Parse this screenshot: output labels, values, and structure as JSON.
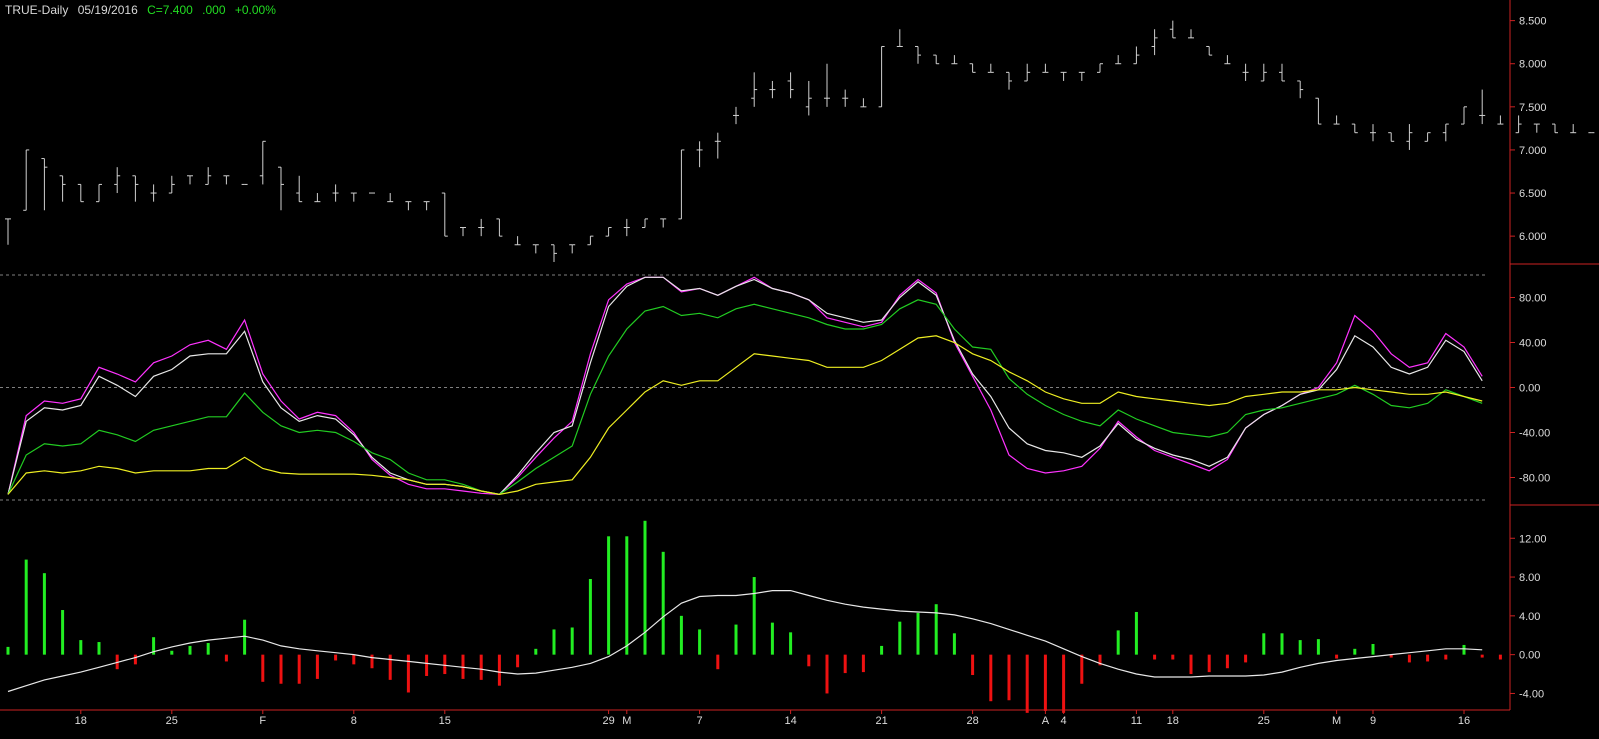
{
  "header": {
    "symbol": "TRUE-Daily",
    "date": "05/19/2016",
    "close": "C=7.400",
    "change": ".000",
    "pct": "+0.00%"
  },
  "colors": {
    "bg": "#000000",
    "axis": "#cc2222",
    "bars": "#d0d0d0",
    "pos": "#22ee22",
    "neg": "#ee1111",
    "magenta": "#ff33ff",
    "white": "#e8e8e8",
    "green": "#22cc22",
    "yellow": "#eeee22",
    "grid": "#aaaaaa"
  },
  "chart_data": [
    {
      "panel": "price",
      "type": "ohlc",
      "ylim": [
        5.7,
        8.6
      ],
      "yticks": [
        "8.500",
        "8.000",
        "7.500",
        "7.000",
        "6.500",
        "6.000"
      ],
      "yvals": [
        8.5,
        8.0,
        7.5,
        7.0,
        6.5,
        6.0
      ],
      "bars": [
        [
          6.2,
          5.8,
          5.9,
          6.2
        ],
        [
          6.3,
          7.0,
          6.3,
          7.0
        ],
        [
          6.9,
          6.9,
          6.3,
          6.8
        ],
        [
          6.7,
          6.7,
          6.4,
          6.6
        ],
        [
          6.6,
          6.6,
          6.4,
          6.4
        ],
        [
          6.4,
          6.6,
          6.4,
          6.6
        ],
        [
          6.6,
          6.8,
          6.5,
          6.7
        ],
        [
          6.7,
          6.7,
          6.4,
          6.6
        ],
        [
          6.5,
          6.6,
          6.4,
          6.5
        ],
        [
          6.5,
          6.7,
          6.5,
          6.6
        ],
        [
          6.7,
          6.7,
          6.6,
          6.7
        ],
        [
          6.6,
          6.8,
          6.6,
          6.7
        ],
        [
          6.7,
          6.7,
          6.6,
          6.7
        ],
        [
          6.6,
          6.6,
          6.6,
          6.6
        ],
        [
          6.7,
          7.1,
          6.6,
          7.1
        ],
        [
          6.8,
          6.8,
          6.3,
          6.6
        ],
        [
          6.5,
          6.7,
          6.4,
          6.4
        ],
        [
          6.4,
          6.5,
          6.4,
          6.4
        ],
        [
          6.5,
          6.6,
          6.4,
          6.5
        ],
        [
          6.5,
          6.5,
          6.4,
          6.5
        ],
        [
          6.5,
          6.5,
          6.5,
          6.5
        ],
        [
          6.4,
          6.5,
          6.4,
          6.4
        ],
        [
          6.4,
          6.4,
          6.3,
          6.4
        ],
        [
          6.4,
          6.4,
          6.3,
          6.4
        ],
        [
          6.5,
          6.5,
          6.0,
          6.0
        ],
        [
          6.1,
          6.1,
          6.0,
          6.1
        ],
        [
          6.1,
          6.2,
          6.0,
          6.1
        ],
        [
          6.2,
          6.2,
          6.0,
          6.0
        ],
        [
          5.9,
          6.0,
          5.9,
          5.9
        ],
        [
          5.9,
          5.9,
          5.8,
          5.9
        ],
        [
          5.9,
          5.9,
          5.7,
          5.8
        ],
        [
          5.9,
          5.9,
          5.8,
          5.9
        ],
        [
          5.9,
          6.0,
          5.9,
          6.0
        ],
        [
          6.0,
          6.1,
          6.0,
          6.1
        ],
        [
          6.1,
          6.2,
          6.0,
          6.1
        ],
        [
          6.1,
          6.2,
          6.1,
          6.2
        ],
        [
          6.2,
          6.2,
          6.1,
          6.2
        ],
        [
          6.2,
          7.0,
          6.2,
          7.0
        ],
        [
          7.0,
          7.1,
          6.8,
          7.0
        ],
        [
          7.1,
          7.2,
          6.9,
          7.1
        ],
        [
          7.4,
          7.5,
          7.3,
          7.4
        ],
        [
          7.6,
          7.9,
          7.5,
          7.7
        ],
        [
          7.7,
          7.8,
          7.6,
          7.7
        ],
        [
          7.8,
          7.9,
          7.6,
          7.7
        ],
        [
          7.5,
          7.8,
          7.4,
          7.6
        ],
        [
          7.6,
          8.0,
          7.5,
          7.6
        ],
        [
          7.6,
          7.7,
          7.5,
          7.6
        ],
        [
          7.5,
          7.6,
          7.5,
          7.5
        ],
        [
          7.5,
          8.2,
          7.5,
          8.2
        ],
        [
          8.2,
          8.4,
          8.2,
          8.2
        ],
        [
          8.2,
          8.2,
          8.0,
          8.1
        ],
        [
          8.1,
          8.1,
          8.0,
          8.0
        ],
        [
          8.0,
          8.1,
          8.0,
          8.0
        ],
        [
          8.0,
          8.0,
          7.9,
          7.9
        ],
        [
          7.9,
          8.0,
          7.9,
          7.9
        ],
        [
          7.9,
          7.9,
          7.7,
          7.8
        ],
        [
          7.8,
          8.0,
          7.8,
          7.9
        ],
        [
          7.9,
          8.0,
          7.9,
          7.9
        ],
        [
          7.9,
          7.9,
          7.8,
          7.9
        ],
        [
          7.9,
          7.9,
          7.8,
          7.9
        ],
        [
          7.9,
          8.0,
          7.9,
          8.0
        ],
        [
          8.0,
          8.1,
          8.0,
          8.0
        ],
        [
          8.0,
          8.2,
          8.0,
          8.1
        ],
        [
          8.2,
          8.4,
          8.1,
          8.3
        ],
        [
          8.4,
          8.5,
          8.3,
          8.3
        ],
        [
          8.3,
          8.4,
          8.3,
          8.3
        ],
        [
          8.2,
          8.2,
          8.1,
          8.1
        ],
        [
          8.0,
          8.1,
          8.0,
          8.0
        ],
        [
          7.9,
          8.0,
          7.8,
          7.9
        ],
        [
          7.8,
          8.0,
          7.8,
          7.9
        ],
        [
          7.9,
          8.0,
          7.8,
          7.8
        ],
        [
          7.8,
          7.8,
          7.6,
          7.7
        ],
        [
          7.6,
          7.6,
          7.3,
          7.3
        ],
        [
          7.3,
          7.4,
          7.3,
          7.3
        ],
        [
          7.3,
          7.3,
          7.2,
          7.2
        ],
        [
          7.2,
          7.3,
          7.1,
          7.2
        ],
        [
          7.2,
          7.2,
          7.1,
          7.1
        ],
        [
          7.1,
          7.3,
          7.0,
          7.2
        ],
        [
          7.1,
          7.2,
          7.1,
          7.2
        ],
        [
          7.2,
          7.3,
          7.1,
          7.3
        ],
        [
          7.3,
          7.5,
          7.3,
          7.5
        ],
        [
          7.4,
          7.7,
          7.3,
          7.4
        ],
        [
          7.3,
          7.4,
          7.3,
          7.3
        ],
        [
          7.2,
          7.4,
          7.2,
          7.3
        ],
        [
          7.3,
          7.3,
          7.2,
          7.3
        ],
        [
          7.3,
          7.3,
          7.2,
          7.2
        ],
        [
          7.2,
          7.3,
          7.2,
          7.2
        ],
        [
          7.2,
          7.2,
          7.2,
          7.2
        ],
        [
          7.2,
          7.2,
          7.1,
          7.2
        ],
        [
          7.2,
          7.3,
          7.1,
          7.2
        ],
        [
          7.2,
          7.3,
          7.2,
          7.3
        ],
        [
          7.3,
          7.5,
          7.3,
          7.4
        ],
        [
          7.4,
          7.5,
          7.3,
          7.4
        ],
        [
          7.4,
          7.5,
          7.3,
          7.4
        ],
        [
          7.4,
          7.5,
          7.3,
          7.4
        ],
        [
          7.4,
          7.5,
          7.3,
          7.5
        ],
        [
          7.5,
          7.5,
          7.3,
          7.4
        ],
        [
          7.4,
          7.5,
          7.3,
          7.4
        ],
        [
          7.4,
          7.5,
          7.3,
          7.4
        ],
        [
          7.5,
          7.6,
          7.4,
          7.5
        ],
        [
          7.5,
          7.5,
          7.4,
          7.4
        ],
        [
          7.4,
          7.5,
          7.3,
          7.4
        ],
        [
          7.4,
          7.5,
          7.3,
          7.4
        ],
        [
          7.5,
          7.5,
          7.4,
          7.5
        ],
        [
          7.4,
          7.5,
          7.3,
          7.4
        ],
        [
          7.5,
          7.6,
          7.4,
          7.5
        ],
        [
          7.5,
          7.5,
          7.4,
          7.4
        ],
        [
          7.4,
          7.5,
          7.3,
          7.4
        ]
      ]
    },
    {
      "panel": "oscillator",
      "type": "line",
      "ylim": [
        -100,
        100
      ],
      "yticks": [
        "80.00",
        "40.00",
        "0.00",
        "-40.00",
        "-80.00"
      ],
      "yvals": [
        80,
        40,
        0,
        -40,
        -80
      ],
      "dashed_levels": [
        100,
        0,
        -100
      ],
      "series": [
        {
          "color": "magenta",
          "values": [
            -95,
            -25,
            -12,
            -14,
            -10,
            18,
            12,
            5,
            22,
            28,
            38,
            42,
            34,
            60,
            12,
            -12,
            -28,
            -22,
            -25,
            -40,
            -64,
            -78,
            -86,
            -90,
            -90,
            -92,
            -94,
            -95,
            -80,
            -62,
            -45,
            -30,
            30,
            78,
            92,
            98,
            98,
            85,
            88,
            82,
            90,
            98,
            88,
            84,
            78,
            62,
            58,
            54,
            58,
            82,
            96,
            84,
            40,
            10,
            -20,
            -60,
            -72,
            -76,
            -74,
            -70,
            -54,
            -30,
            -44,
            -56,
            -62,
            -68,
            -74,
            -64,
            -36,
            -24,
            -16,
            -6,
            0,
            22,
            64,
            50,
            30,
            18,
            22,
            48,
            36,
            10
          ]
        },
        {
          "color": "white",
          "values": [
            -95,
            -30,
            -18,
            -20,
            -16,
            10,
            2,
            -8,
            10,
            16,
            28,
            30,
            30,
            50,
            5,
            -18,
            -30,
            -25,
            -28,
            -42,
            -62,
            -76,
            -82,
            -86,
            -86,
            -88,
            -92,
            -95,
            -78,
            -58,
            -40,
            -34,
            22,
            72,
            90,
            98,
            98,
            86,
            88,
            82,
            90,
            96,
            88,
            84,
            78,
            66,
            62,
            58,
            60,
            80,
            94,
            82,
            42,
            12,
            -8,
            -36,
            -50,
            -56,
            -58,
            -62,
            -52,
            -32,
            -46,
            -54,
            -60,
            -64,
            -70,
            -62,
            -36,
            -24,
            -16,
            -6,
            -2,
            16,
            46,
            36,
            18,
            12,
            18,
            42,
            32,
            6
          ]
        },
        {
          "color": "green",
          "values": [
            -95,
            -60,
            -50,
            -52,
            -50,
            -38,
            -42,
            -48,
            -38,
            -34,
            -30,
            -26,
            -26,
            -5,
            -22,
            -34,
            -40,
            -38,
            -40,
            -48,
            -58,
            -64,
            -76,
            -82,
            -82,
            -86,
            -92,
            -95,
            -84,
            -72,
            -62,
            -52,
            -6,
            28,
            52,
            68,
            72,
            64,
            66,
            62,
            70,
            74,
            70,
            66,
            62,
            56,
            52,
            52,
            56,
            70,
            78,
            74,
            52,
            36,
            34,
            8,
            -6,
            -16,
            -24,
            -30,
            -34,
            -20,
            -28,
            -34,
            -40,
            -42,
            -44,
            -40,
            -24,
            -20,
            -18,
            -14,
            -10,
            -6,
            2,
            -6,
            -16,
            -18,
            -14,
            -2,
            -8,
            -14
          ]
        },
        {
          "color": "yellow",
          "values": [
            -95,
            -76,
            -74,
            -76,
            -74,
            -70,
            -72,
            -76,
            -74,
            -74,
            -74,
            -72,
            -72,
            -62,
            -72,
            -76,
            -77,
            -77,
            -77,
            -77,
            -78,
            -80,
            -82,
            -86,
            -86,
            -88,
            -92,
            -95,
            -92,
            -86,
            -84,
            -82,
            -62,
            -36,
            -20,
            -4,
            6,
            2,
            6,
            6,
            18,
            30,
            28,
            26,
            24,
            18,
            18,
            18,
            24,
            34,
            44,
            46,
            40,
            30,
            24,
            14,
            6,
            -4,
            -10,
            -14,
            -14,
            -4,
            -8,
            -10,
            -12,
            -14,
            -16,
            -14,
            -8,
            -6,
            -4,
            -4,
            -2,
            -2,
            0,
            -2,
            -4,
            -6,
            -6,
            -4,
            -8,
            -12
          ]
        }
      ]
    },
    {
      "panel": "histogram",
      "type": "bar",
      "ylim": [
        -5.5,
        14.5
      ],
      "yticks": [
        "12.00",
        "8.00",
        "4.00",
        "0.00",
        "-4.00"
      ],
      "yvals": [
        12,
        8,
        4,
        0,
        -4
      ],
      "values": [
        0.8,
        9.8,
        8.4,
        4.6,
        1.5,
        1.3,
        -1.5,
        -1.0,
        1.8,
        0.4,
        0.9,
        1.2,
        -0.7,
        3.6,
        -2.8,
        -3.0,
        -3.0,
        -2.5,
        -0.6,
        -1.0,
        -1.4,
        -2.6,
        -3.9,
        -2.2,
        -2.0,
        -2.5,
        -2.6,
        -3.2,
        -1.3,
        0.6,
        2.6,
        2.8,
        7.8,
        12.2,
        12.2,
        13.8,
        10.6,
        4.0,
        2.6,
        -1.5,
        3.1,
        8.0,
        3.3,
        2.3,
        -1.2,
        -4.0,
        -1.9,
        -1.8,
        0.9,
        3.4,
        4.3,
        5.2,
        2.2,
        -2.1,
        -4.8,
        -4.7,
        -6.0,
        -5.8,
        -6.0,
        -3.0,
        -1.1,
        2.5,
        4.4,
        -0.5,
        -0.5,
        -2.0,
        -1.8,
        -1.4,
        -0.8,
        2.2,
        2.2,
        1.5,
        1.6,
        -0.4,
        0.6,
        1.1,
        -0.3,
        -0.8,
        -0.7,
        -0.5,
        1.0,
        -0.3,
        -0.5
      ],
      "signal": [
        -3.8,
        -3.2,
        -2.6,
        -2.2,
        -1.8,
        -1.3,
        -0.8,
        -0.3,
        0.3,
        0.8,
        1.2,
        1.5,
        1.7,
        1.9,
        1.5,
        0.9,
        0.6,
        0.4,
        0.2,
        0.0,
        -0.3,
        -0.5,
        -0.7,
        -0.9,
        -1.1,
        -1.3,
        -1.5,
        -1.8,
        -2.0,
        -1.9,
        -1.6,
        -1.3,
        -0.9,
        -0.2,
        0.9,
        2.3,
        3.9,
        5.3,
        6.0,
        6.1,
        6.1,
        6.3,
        6.6,
        6.6,
        6.1,
        5.6,
        5.2,
        4.9,
        4.7,
        4.5,
        4.4,
        4.3,
        4.1,
        3.7,
        3.2,
        2.6,
        2.0,
        1.4,
        0.6,
        -0.2,
        -0.9,
        -1.5,
        -2.0,
        -2.3,
        -2.3,
        -2.3,
        -2.2,
        -2.2,
        -2.2,
        -2.1,
        -1.8,
        -1.3,
        -0.9,
        -0.6,
        -0.4,
        -0.2,
        0.0,
        0.2,
        0.4,
        0.6,
        0.6,
        0.5
      ]
    }
  ],
  "xaxis": {
    "labels": [
      {
        "i": 4,
        "t": "18"
      },
      {
        "i": 9,
        "t": "25"
      },
      {
        "i": 14,
        "t": "F"
      },
      {
        "i": 19,
        "t": "8"
      },
      {
        "i": 24,
        "t": "15"
      },
      {
        "i": 33,
        "t": "29"
      },
      {
        "i": 34,
        "t": "M"
      },
      {
        "i": 38,
        "t": "7"
      },
      {
        "i": 43,
        "t": "14"
      },
      {
        "i": 48,
        "t": "21"
      },
      {
        "i": 53,
        "t": "28"
      },
      {
        "i": 57,
        "t": "A"
      },
      {
        "i": 58,
        "t": "4"
      },
      {
        "i": 62,
        "t": "11"
      },
      {
        "i": 64,
        "t": "18"
      },
      {
        "i": 69,
        "t": "25"
      },
      {
        "i": 73,
        "t": "M"
      },
      {
        "i": 75,
        "t": "9"
      },
      {
        "i": 80,
        "t": "16"
      }
    ]
  }
}
